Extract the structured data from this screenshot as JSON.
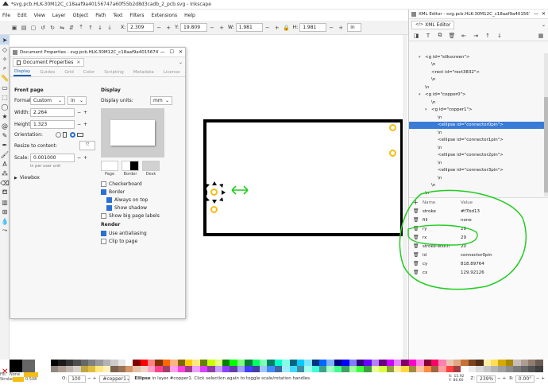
{
  "window": {
    "title": "*svg.pcb.HLK-30M12C_c18aaf9a40156747a60f55b2d8d3cadb_2_pcb.svg - Inkscape"
  },
  "menubar": [
    "File",
    "Edit",
    "View",
    "Layer",
    "Object",
    "Path",
    "Text",
    "Filters",
    "Extensions",
    "Help"
  ],
  "toolbar": {
    "x_label": "X:",
    "x_value": "2.309",
    "y_label": "Y:",
    "y_value": "19.809",
    "w_label": "W:",
    "w_value": "1.981",
    "h_label": "H:",
    "h_value": "1.981",
    "unit": "in"
  },
  "docprops": {
    "title": "Document Properties - svg.pcb.HLK-30M12C_c18aaf9a40156747a60f55b2d...",
    "tab_label": "Document Properties",
    "tabs": [
      "Display",
      "Guides",
      "Grid",
      "Color",
      "Scripting",
      "Metadata",
      "License"
    ],
    "front_page": "Front page",
    "format_label": "Format:",
    "format_value": "Custom",
    "format_unit": "in",
    "width_label": "Width:",
    "width_value": "2.264",
    "height_label": "Height:",
    "height_value": "1.323",
    "orientation_label": "Orientation:",
    "resize_label": "Resize to content:",
    "scale_label": "Scale:",
    "scale_value": "0.001000",
    "per_user_unit": "in per user unit",
    "viewbox_label": "Viewbox",
    "display_heading": "Display",
    "display_units_label": "Display units:",
    "display_units_value": "mm",
    "swatch_labels": [
      "Page",
      "Border",
      "Desk"
    ],
    "checks": [
      {
        "label": "Checkerboard",
        "checked": false,
        "indent": false
      },
      {
        "label": "Border",
        "checked": true,
        "indent": false
      },
      {
        "label": "Always on top",
        "checked": true,
        "indent": true
      },
      {
        "label": "Show shadow",
        "checked": true,
        "indent": true
      },
      {
        "label": "Show big page labels",
        "checked": false,
        "indent": false
      }
    ],
    "render_heading": "Render",
    "render_checks": [
      {
        "label": "Use antialiasing",
        "checked": true
      },
      {
        "label": "Clip to page",
        "checked": false
      }
    ]
  },
  "xml": {
    "title": "XML Editor - svg.pcb.HLK-30M12C_c18aaf9a40156747a...",
    "tab_label": "XML Editor",
    "nodes": [
      {
        "indent": 1,
        "arrow": "▾",
        "text": "<g id=\"silkscreen\">",
        "sel": false
      },
      {
        "indent": 2,
        "arrow": "",
        "text": "\\n",
        "sel": false
      },
      {
        "indent": 2,
        "arrow": "",
        "text": "<rect id=\"rect3832\">",
        "sel": false
      },
      {
        "indent": 2,
        "arrow": "",
        "text": "\\n",
        "sel": false
      },
      {
        "indent": 1,
        "arrow": "",
        "text": "\\n",
        "sel": false
      },
      {
        "indent": 1,
        "arrow": "▾",
        "text": "<g id=\"copper0\">",
        "sel": false
      },
      {
        "indent": 2,
        "arrow": "",
        "text": "\\n",
        "sel": false
      },
      {
        "indent": 2,
        "arrow": "▾",
        "text": "<g id=\"copper1\">",
        "sel": false
      },
      {
        "indent": 3,
        "arrow": "",
        "text": "\\n",
        "sel": false
      },
      {
        "indent": 3,
        "arrow": "",
        "text": "<ellipse id=\"connector0pin\">",
        "sel": true
      },
      {
        "indent": 3,
        "arrow": "",
        "text": "\\n",
        "sel": false
      },
      {
        "indent": 3,
        "arrow": "",
        "text": "<ellipse id=\"connector1pin\">",
        "sel": false
      },
      {
        "indent": 3,
        "arrow": "",
        "text": "\\n",
        "sel": false
      },
      {
        "indent": 3,
        "arrow": "",
        "text": "<ellipse id=\"connector2pin\">",
        "sel": false
      },
      {
        "indent": 3,
        "arrow": "",
        "text": "\\n",
        "sel": false
      },
      {
        "indent": 3,
        "arrow": "",
        "text": "<ellipse id=\"connector3pin\">",
        "sel": false
      },
      {
        "indent": 3,
        "arrow": "",
        "text": "\\n",
        "sel": false
      },
      {
        "indent": 2,
        "arrow": "",
        "text": "\\n",
        "sel": false
      },
      {
        "indent": 1,
        "arrow": "",
        "text": "\\n",
        "sel": false
      }
    ],
    "col_name": "Name",
    "col_value": "Value",
    "attrs": [
      {
        "name": "stroke",
        "value": "#f7bd13"
      },
      {
        "name": "fill",
        "value": "none"
      },
      {
        "name": "ry",
        "value": "29"
      },
      {
        "name": "rx",
        "value": "29"
      },
      {
        "name": "stroke-width",
        "value": "20"
      },
      {
        "name": "id",
        "value": "connector0pin"
      },
      {
        "name": "cy",
        "value": "818.89764"
      },
      {
        "name": "cx",
        "value": "129.92126"
      }
    ]
  },
  "statusbar": {
    "fill_label": "Fill:",
    "stroke_label": "Stroke:",
    "fill_value": "None",
    "stroke_width": "0.508",
    "opacity_label": "O:",
    "opacity_value": "100",
    "layer": "#copper1",
    "message_bold": "Ellipse",
    "message": " in layer #copper1. Click selection again to toggle scale/rotation handles.",
    "x_label": "X:",
    "x_value": "15.92",
    "y_label": "Y:",
    "y_value": "80.60",
    "z_label": "Z:",
    "zoom": "239%",
    "r_label": "R:",
    "rotation": "0.00°"
  },
  "colors": {
    "accent": "#3a7bd5",
    "selection": "#3a7bd5",
    "annotation": "#22cc22",
    "pin": "#f7bd13"
  },
  "palette": [
    "#000000",
    "#1a1a1a",
    "#333333",
    "#4d4d4d",
    "#666666",
    "#808080",
    "#999999",
    "#b3b3b3",
    "#cccccc",
    "#e6e6e6",
    "#ffffff",
    "#800000",
    "#ff0000",
    "#ff8080",
    "#803300",
    "#ff6600",
    "#ffb380",
    "#806600",
    "#ffcc00",
    "#ffe680",
    "#668000",
    "#ccff00",
    "#e5ff80",
    "#008000",
    "#00ff00",
    "#80ff80",
    "#008033",
    "#00ff66",
    "#80ffb3",
    "#008066",
    "#00ffcc",
    "#80ffe6",
    "#006680",
    "#00ccff",
    "#80e5ff",
    "#003380",
    "#0066ff",
    "#80b3ff",
    "#000080",
    "#0000ff",
    "#8080ff",
    "#330080",
    "#6600ff",
    "#b380ff",
    "#660080",
    "#cc00ff",
    "#e580ff",
    "#800066",
    "#ff00cc",
    "#ff80e5",
    "#800033",
    "#ff0066",
    "#ff80b2",
    "#e9c6af",
    "#deaa87",
    "#c87137",
    "#784421",
    "#502d16",
    "#ffeeaa",
    "#ffdd55",
    "#d4aa00",
    "#aa8800",
    "#c8beb7",
    "#ac9d93",
    "#917c6f",
    "#6c5d53"
  ]
}
